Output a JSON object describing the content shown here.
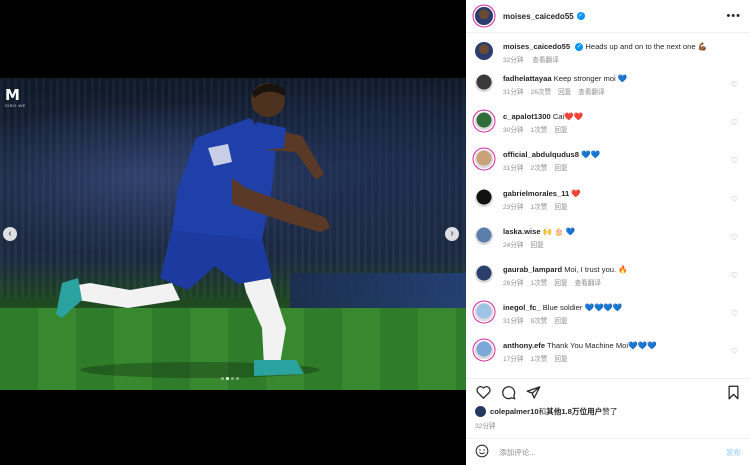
{
  "post": {
    "author": "moises_caicedo55",
    "more_label": "•••",
    "slide_count": 4,
    "active_slide": 1,
    "watermark_text": "SIRO.WE"
  },
  "caption": {
    "user": "moises_caicedo55",
    "text": "Heads up and on to the next one 💪🏾",
    "time": "32分钟",
    "translate": "查看翻译"
  },
  "comments": [
    {
      "user": "fadhelattayaa",
      "text": "Keep stronger moi ",
      "emoji": "💙",
      "emoji_class": "emoji-blue",
      "time": "31分钟",
      "likes": "26次赞",
      "reply": "回复",
      "translate": "查看翻译",
      "avatar": "#3a3a3a",
      "ring": false
    },
    {
      "user": "c_apalot1300",
      "text": "Cai",
      "emoji": "❤️❤️",
      "emoji_class": "emoji-red",
      "time": "30分钟",
      "likes": "1次赞",
      "reply": "回复",
      "translate": "",
      "avatar": "#2f6e3a",
      "ring": true
    },
    {
      "user": "official_abdulqudus8",
      "text": "",
      "emoji": "💙💙",
      "emoji_class": "emoji-blue",
      "time": "31分钟",
      "likes": "2次赞",
      "reply": "回复",
      "translate": "",
      "avatar": "#c9a27a",
      "ring": true
    },
    {
      "user": "gabrielmorales_11",
      "text": "",
      "emoji": "❤️",
      "emoji_class": "emoji-red",
      "time": "23分钟",
      "likes": "1次赞",
      "reply": "回复",
      "translate": "",
      "avatar": "#111111",
      "ring": false
    },
    {
      "user": "laska.wise",
      "text": "",
      "emoji": "🙌 🎂 💙",
      "emoji_class": "emoji-blue",
      "time": "24分钟",
      "likes": "",
      "reply": "回复",
      "translate": "",
      "avatar": "#5b7fa8",
      "ring": false
    },
    {
      "user": "gaurab_lampard",
      "text": "Moi, I trust you. ",
      "emoji": "🔥",
      "emoji_class": "emoji-fire",
      "time": "26分钟",
      "likes": "1次赞",
      "reply": "回复",
      "translate": "查看翻译",
      "avatar": "#2a3f6b",
      "ring": false
    },
    {
      "user": "inegol_fc_",
      "text": "Blue soldier ",
      "emoji": "💙💙💙💙",
      "emoji_class": "emoji-blue",
      "time": "31分钟",
      "likes": "9次赞",
      "reply": "回复",
      "translate": "",
      "avatar": "#9ec3e6",
      "ring": true
    },
    {
      "user": "anthony.efe",
      "text": "Thank You Machine Moi",
      "emoji": "💙💙💙",
      "emoji_class": "emoji-blue",
      "time": "17分钟",
      "likes": "1次赞",
      "reply": "回复",
      "translate": "",
      "avatar": "#7aa7d8",
      "ring": true
    }
  ],
  "likes_line": {
    "user": "colepalmer10",
    "mid": "和",
    "others": "其他1.8万位用户",
    "suffix": "赞了"
  },
  "post_time": "32分钟",
  "composer": {
    "placeholder": "添加评论...",
    "post_label": "发布"
  },
  "icons": {
    "heart": "heart-icon",
    "comment": "comment-icon",
    "share": "share-icon",
    "save": "bookmark-icon",
    "emoji": "emoji-icon",
    "verified": "verified-badge-icon",
    "prev": "chevron-left-icon",
    "next": "chevron-right-icon"
  },
  "colors": {
    "accent": "#0095f6",
    "muted": "#8e8e8e",
    "club_blue": "#1d3f96"
  }
}
